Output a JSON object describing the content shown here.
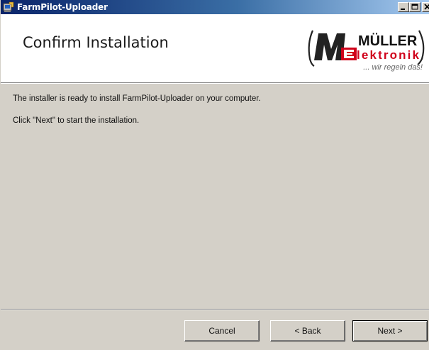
{
  "window": {
    "title": "FarmPilot-Uploader",
    "controls": {
      "minimize": "minimize-icon",
      "maximize": "maximize-icon",
      "close": "close-icon"
    }
  },
  "banner": {
    "heading": "Confirm Installation",
    "logo_text_top": "MÜLLER",
    "logo_text_bottom": "Elektronik",
    "logo_slogan": "... wir regeln das!",
    "logo_color": "#d0021b"
  },
  "content": {
    "line1": "The installer is ready to install FarmPilot-Uploader on your computer.",
    "line2": "Click \"Next\" to start the installation."
  },
  "buttons": {
    "cancel": "Cancel",
    "back": "< Back",
    "next": "Next >"
  }
}
